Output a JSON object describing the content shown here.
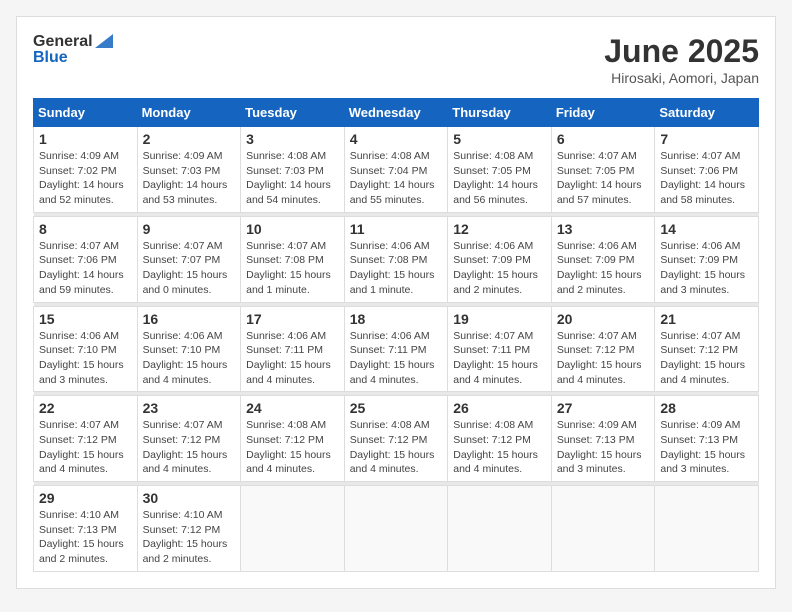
{
  "header": {
    "logo_general": "General",
    "logo_blue": "Blue",
    "month_title": "June 2025",
    "location": "Hirosaki, Aomori, Japan"
  },
  "days_of_week": [
    "Sunday",
    "Monday",
    "Tuesday",
    "Wednesday",
    "Thursday",
    "Friday",
    "Saturday"
  ],
  "weeks": [
    {
      "days": [
        {
          "num": "1",
          "info": "Sunrise: 4:09 AM\nSunset: 7:02 PM\nDaylight: 14 hours\nand 52 minutes."
        },
        {
          "num": "2",
          "info": "Sunrise: 4:09 AM\nSunset: 7:03 PM\nDaylight: 14 hours\nand 53 minutes."
        },
        {
          "num": "3",
          "info": "Sunrise: 4:08 AM\nSunset: 7:03 PM\nDaylight: 14 hours\nand 54 minutes."
        },
        {
          "num": "4",
          "info": "Sunrise: 4:08 AM\nSunset: 7:04 PM\nDaylight: 14 hours\nand 55 minutes."
        },
        {
          "num": "5",
          "info": "Sunrise: 4:08 AM\nSunset: 7:05 PM\nDaylight: 14 hours\nand 56 minutes."
        },
        {
          "num": "6",
          "info": "Sunrise: 4:07 AM\nSunset: 7:05 PM\nDaylight: 14 hours\nand 57 minutes."
        },
        {
          "num": "7",
          "info": "Sunrise: 4:07 AM\nSunset: 7:06 PM\nDaylight: 14 hours\nand 58 minutes."
        }
      ]
    },
    {
      "days": [
        {
          "num": "8",
          "info": "Sunrise: 4:07 AM\nSunset: 7:06 PM\nDaylight: 14 hours\nand 59 minutes."
        },
        {
          "num": "9",
          "info": "Sunrise: 4:07 AM\nSunset: 7:07 PM\nDaylight: 15 hours\nand 0 minutes."
        },
        {
          "num": "10",
          "info": "Sunrise: 4:07 AM\nSunset: 7:08 PM\nDaylight: 15 hours\nand 1 minute."
        },
        {
          "num": "11",
          "info": "Sunrise: 4:06 AM\nSunset: 7:08 PM\nDaylight: 15 hours\nand 1 minute."
        },
        {
          "num": "12",
          "info": "Sunrise: 4:06 AM\nSunset: 7:09 PM\nDaylight: 15 hours\nand 2 minutes."
        },
        {
          "num": "13",
          "info": "Sunrise: 4:06 AM\nSunset: 7:09 PM\nDaylight: 15 hours\nand 2 minutes."
        },
        {
          "num": "14",
          "info": "Sunrise: 4:06 AM\nSunset: 7:09 PM\nDaylight: 15 hours\nand 3 minutes."
        }
      ]
    },
    {
      "days": [
        {
          "num": "15",
          "info": "Sunrise: 4:06 AM\nSunset: 7:10 PM\nDaylight: 15 hours\nand 3 minutes."
        },
        {
          "num": "16",
          "info": "Sunrise: 4:06 AM\nSunset: 7:10 PM\nDaylight: 15 hours\nand 4 minutes."
        },
        {
          "num": "17",
          "info": "Sunrise: 4:06 AM\nSunset: 7:11 PM\nDaylight: 15 hours\nand 4 minutes."
        },
        {
          "num": "18",
          "info": "Sunrise: 4:06 AM\nSunset: 7:11 PM\nDaylight: 15 hours\nand 4 minutes."
        },
        {
          "num": "19",
          "info": "Sunrise: 4:07 AM\nSunset: 7:11 PM\nDaylight: 15 hours\nand 4 minutes."
        },
        {
          "num": "20",
          "info": "Sunrise: 4:07 AM\nSunset: 7:12 PM\nDaylight: 15 hours\nand 4 minutes."
        },
        {
          "num": "21",
          "info": "Sunrise: 4:07 AM\nSunset: 7:12 PM\nDaylight: 15 hours\nand 4 minutes."
        }
      ]
    },
    {
      "days": [
        {
          "num": "22",
          "info": "Sunrise: 4:07 AM\nSunset: 7:12 PM\nDaylight: 15 hours\nand 4 minutes."
        },
        {
          "num": "23",
          "info": "Sunrise: 4:07 AM\nSunset: 7:12 PM\nDaylight: 15 hours\nand 4 minutes."
        },
        {
          "num": "24",
          "info": "Sunrise: 4:08 AM\nSunset: 7:12 PM\nDaylight: 15 hours\nand 4 minutes."
        },
        {
          "num": "25",
          "info": "Sunrise: 4:08 AM\nSunset: 7:12 PM\nDaylight: 15 hours\nand 4 minutes."
        },
        {
          "num": "26",
          "info": "Sunrise: 4:08 AM\nSunset: 7:12 PM\nDaylight: 15 hours\nand 4 minutes."
        },
        {
          "num": "27",
          "info": "Sunrise: 4:09 AM\nSunset: 7:13 PM\nDaylight: 15 hours\nand 3 minutes."
        },
        {
          "num": "28",
          "info": "Sunrise: 4:09 AM\nSunset: 7:13 PM\nDaylight: 15 hours\nand 3 minutes."
        }
      ]
    },
    {
      "days": [
        {
          "num": "29",
          "info": "Sunrise: 4:10 AM\nSunset: 7:13 PM\nDaylight: 15 hours\nand 2 minutes."
        },
        {
          "num": "30",
          "info": "Sunrise: 4:10 AM\nSunset: 7:12 PM\nDaylight: 15 hours\nand 2 minutes."
        },
        {
          "num": "",
          "info": ""
        },
        {
          "num": "",
          "info": ""
        },
        {
          "num": "",
          "info": ""
        },
        {
          "num": "",
          "info": ""
        },
        {
          "num": "",
          "info": ""
        }
      ]
    }
  ]
}
